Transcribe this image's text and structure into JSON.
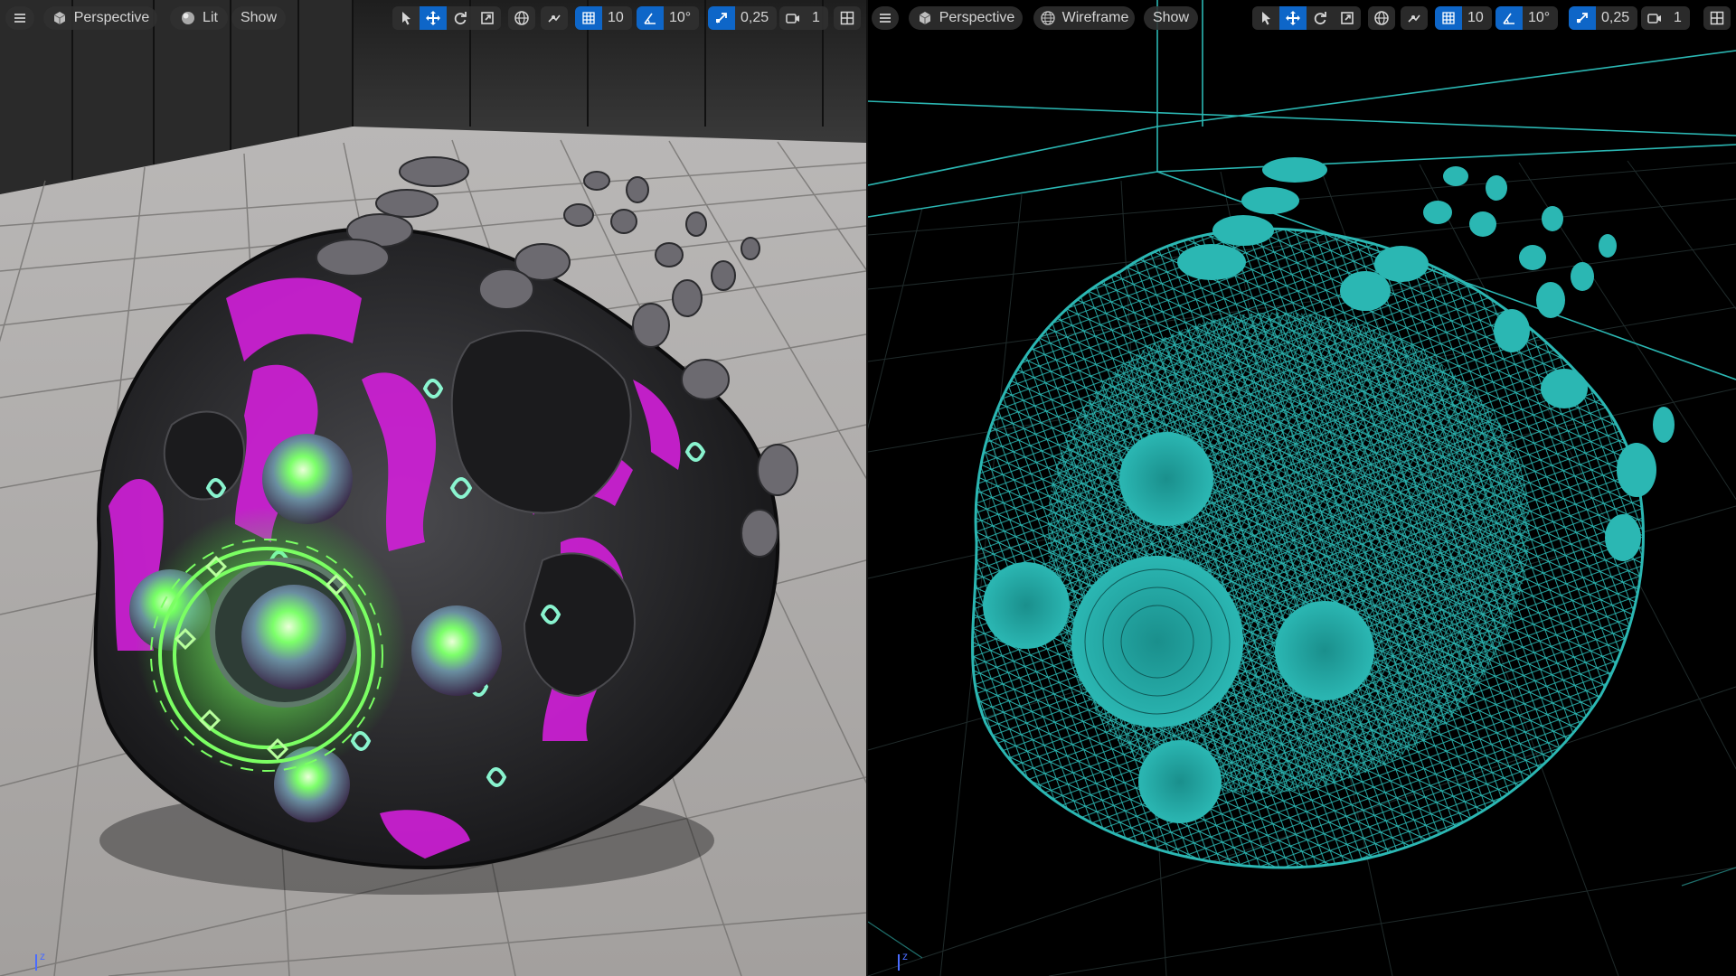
{
  "left_viewport": {
    "menu_icon": "hamburger-menu-icon",
    "view_mode_button": {
      "icon": "perspective-cube-icon",
      "label": "Perspective"
    },
    "lighting_button": {
      "icon": "lit-sphere-icon",
      "label": "Lit"
    },
    "show_button": {
      "label": "Show"
    },
    "transform_tools": [
      "select-icon",
      "translate-icon",
      "rotate-icon",
      "scale-icon"
    ],
    "active_transform": "translate",
    "world_local_icon": "globe-icon",
    "surface_snap_icon": "surface-snap-icon",
    "grid_snap": {
      "icon": "grid-snap-icon",
      "value": "10"
    },
    "rotation_snap": {
      "icon": "angle-snap-icon",
      "value": "10°"
    },
    "scale_snap": {
      "icon": "scale-snap-icon",
      "value": "0,25"
    },
    "camera_speed": {
      "icon": "camera-icon",
      "value": "1"
    },
    "layout_icon": "viewport-layout-icon"
  },
  "right_viewport": {
    "menu_icon": "hamburger-menu-icon",
    "view_mode_button": {
      "icon": "perspective-cube-icon",
      "label": "Perspective"
    },
    "lighting_button": {
      "icon": "wireframe-sphere-icon",
      "label": "Wireframe"
    },
    "show_button": {
      "label": "Show"
    },
    "transform_tools": [
      "select-icon",
      "translate-icon",
      "rotate-icon",
      "scale-icon"
    ],
    "active_transform": "translate",
    "world_local_icon": "globe-icon",
    "surface_snap_icon": "surface-snap-icon",
    "grid_snap": {
      "icon": "grid-snap-icon",
      "value": "10"
    },
    "rotation_snap": {
      "icon": "angle-snap-icon",
      "value": "10°"
    },
    "scale_snap": {
      "icon": "scale-snap-icon",
      "value": "0,25"
    },
    "camera_speed": {
      "icon": "camera-icon",
      "value": "1"
    },
    "layout_icon": "viewport-layout-icon"
  },
  "colors": {
    "accent": "#0e66c8",
    "toolbar_bg": "#303030",
    "wireframe": "#2bb7b3",
    "emissive_green": "#6bff5a",
    "magenta": "#d21fd9",
    "floor_lit": "#a9a5a3"
  }
}
